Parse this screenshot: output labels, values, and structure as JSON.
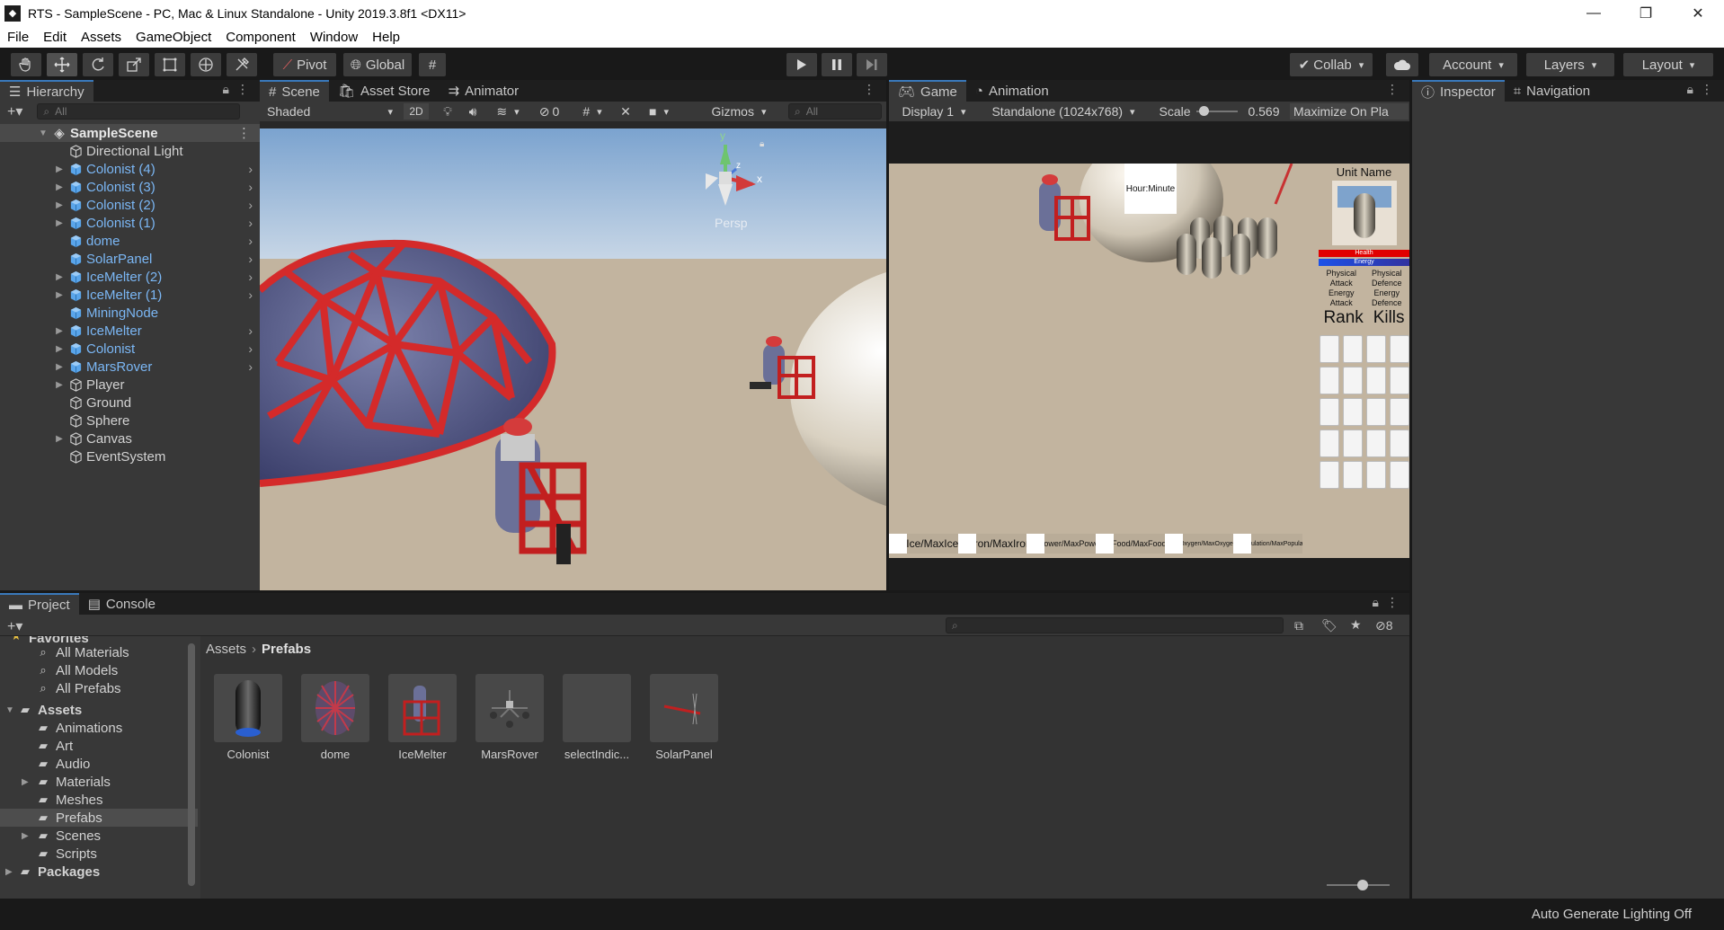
{
  "window": {
    "title": "RTS - SampleScene - PC, Mac & Linux Standalone - Unity 2019.3.8f1 <DX11>",
    "minimize": "—",
    "maximize": "❐",
    "close": "✕"
  },
  "menu": [
    "File",
    "Edit",
    "Assets",
    "GameObject",
    "Component",
    "Window",
    "Help"
  ],
  "toolbar": {
    "pivot": "Pivot",
    "global": "Global",
    "collab": "Collab",
    "account": "Account",
    "layers": "Layers",
    "layout": "Layout"
  },
  "hierarchy": {
    "tab": "Hierarchy",
    "search_placeholder": "All",
    "scene": "SampleScene",
    "items": [
      {
        "label": "Directional Light",
        "prefab": false,
        "fold": false,
        "chev": false
      },
      {
        "label": "Colonist (4)",
        "prefab": true,
        "fold": true,
        "chev": true
      },
      {
        "label": "Colonist (3)",
        "prefab": true,
        "fold": true,
        "chev": true
      },
      {
        "label": "Colonist (2)",
        "prefab": true,
        "fold": true,
        "chev": true
      },
      {
        "label": "Colonist (1)",
        "prefab": true,
        "fold": true,
        "chev": true
      },
      {
        "label": "dome",
        "prefab": true,
        "fold": false,
        "chev": true
      },
      {
        "label": "SolarPanel",
        "prefab": true,
        "fold": false,
        "chev": true
      },
      {
        "label": "IceMelter (2)",
        "prefab": true,
        "fold": true,
        "chev": true
      },
      {
        "label": "IceMelter (1)",
        "prefab": true,
        "fold": true,
        "chev": true
      },
      {
        "label": "MiningNode",
        "prefab": true,
        "fold": false,
        "chev": false
      },
      {
        "label": "IceMelter",
        "prefab": true,
        "fold": true,
        "chev": true
      },
      {
        "label": "Colonist",
        "prefab": true,
        "fold": true,
        "chev": true
      },
      {
        "label": "MarsRover",
        "prefab": true,
        "fold": true,
        "chev": true
      },
      {
        "label": "Player",
        "prefab": false,
        "fold": true,
        "chev": false
      },
      {
        "label": "Ground",
        "prefab": false,
        "fold": false,
        "chev": false
      },
      {
        "label": "Sphere",
        "prefab": false,
        "fold": false,
        "chev": false
      },
      {
        "label": "Canvas",
        "prefab": false,
        "fold": true,
        "chev": false
      },
      {
        "label": "EventSystem",
        "prefab": false,
        "fold": false,
        "chev": false
      }
    ]
  },
  "scene": {
    "tabs": [
      "Scene",
      "Asset Store",
      "Animator"
    ],
    "shading": "Shaded",
    "mode_2d": "2D",
    "hidden_count": "0",
    "gizmos": "Gizmos",
    "search_placeholder": "All",
    "gizmo_labels": {
      "y": "y",
      "x": "x",
      "z": "z",
      "persp": "Persp"
    }
  },
  "game": {
    "tabs": [
      "Game",
      "Animation"
    ],
    "display": "Display 1",
    "resolution": "Standalone (1024x768)",
    "scale_label": "Scale",
    "scale_value": "0.569",
    "scale_fraction": 0.07,
    "maximize": "Maximize On Pla",
    "hud": {
      "clock": "Hour:Minute",
      "unit_name": "Unit Name",
      "health": "Health",
      "energy": "Energy",
      "stats_left": [
        "Physical",
        "Attack",
        "Energy",
        "Attack"
      ],
      "stats_right": [
        "Physical",
        "Defence",
        "Energy",
        "Defence"
      ],
      "rank": "Rank",
      "kills": "Kills",
      "resources": [
        "Ice/MaxIce",
        "Iron/MaxIron",
        "Power/MaxPower",
        "Food/MaxFood",
        "Oxygen/MaxOxygen",
        "population/MaxPopulation"
      ]
    }
  },
  "inspector": {
    "tabs": [
      "Inspector",
      "Navigation"
    ]
  },
  "project": {
    "tabs": [
      "Project",
      "Console"
    ],
    "hidden_count": "8",
    "favorites": "Favorites",
    "favorite_items": [
      "All Materials",
      "All Models",
      "All Prefabs"
    ],
    "assets_root": "Assets",
    "asset_folders": [
      {
        "label": "Animations",
        "fold": false,
        "sel": false
      },
      {
        "label": "Art",
        "fold": false,
        "sel": false
      },
      {
        "label": "Audio",
        "fold": false,
        "sel": false
      },
      {
        "label": "Materials",
        "fold": true,
        "sel": false
      },
      {
        "label": "Meshes",
        "fold": false,
        "sel": false
      },
      {
        "label": "Prefabs",
        "fold": false,
        "sel": true
      },
      {
        "label": "Scenes",
        "fold": true,
        "sel": false
      },
      {
        "label": "Scripts",
        "fold": false,
        "sel": false
      }
    ],
    "packages": "Packages",
    "breadcrumb": [
      "Assets",
      "Prefabs"
    ],
    "assets": [
      "Colonist",
      "dome",
      "IceMelter",
      "MarsRover",
      "selectIndic...",
      "SolarPanel"
    ]
  },
  "status": "Auto Generate Lighting Off",
  "colors": {
    "prefab_text": "#7bb7f5",
    "selection_tab": "#3a79bb",
    "dome_red": "#d42a2a",
    "ground": "#c2b49f"
  }
}
